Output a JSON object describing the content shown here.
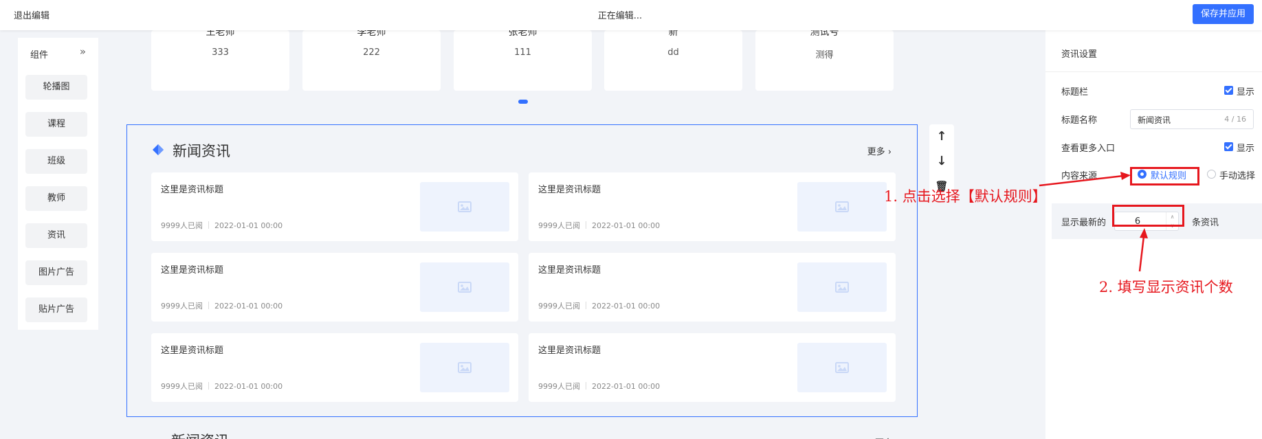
{
  "topbar": {
    "exit_label": "退出编辑",
    "status_text": "正在编辑...",
    "save_label": "保存并应用"
  },
  "components": {
    "header": "组件",
    "collapse_icon": "»",
    "items": [
      "轮播图",
      "课程",
      "班级",
      "教师",
      "资讯",
      "图片广告",
      "贴片广告"
    ]
  },
  "teachers": [
    {
      "name": "王老师",
      "desc": "333"
    },
    {
      "name": "李老师",
      "desc": "222"
    },
    {
      "name": "张老师",
      "desc": "111"
    },
    {
      "name": "新",
      "desc": "dd"
    },
    {
      "name": "测试号",
      "desc": "测得"
    }
  ],
  "news_block": {
    "title": "新闻资讯",
    "more_label": "更多 ›",
    "items": [
      {
        "title": "这里是资讯标题",
        "views": "9999人已阅",
        "date": "2022-01-01 00:00"
      },
      {
        "title": "这里是资讯标题",
        "views": "9999人已阅",
        "date": "2022-01-01 00:00"
      },
      {
        "title": "这里是资讯标题",
        "views": "9999人已阅",
        "date": "2022-01-01 00:00"
      },
      {
        "title": "这里是资讯标题",
        "views": "9999人已阅",
        "date": "2022-01-01 00:00"
      },
      {
        "title": "这里是资讯标题",
        "views": "9999人已阅",
        "date": "2022-01-01 00:00"
      },
      {
        "title": "这里是资讯标题",
        "views": "9999人已阅",
        "date": "2022-01-01 00:00"
      }
    ],
    "next_title": "新闻资讯",
    "next_more": "更多"
  },
  "tools": {
    "up": "↑",
    "down": "↓",
    "delete": "🗑"
  },
  "settings": {
    "title": "资讯设置",
    "title_bar_label": "标题栏",
    "title_bar_check": "显示",
    "title_name_label": "标题名称",
    "title_name_value": "新闻资讯",
    "title_name_count": "4 / 16",
    "more_entry_label": "查看更多入口",
    "more_entry_check": "显示",
    "source_label": "内容来源",
    "source_default": "默认规则",
    "source_manual": "手动选择",
    "latest_label": "显示最新的",
    "latest_value": "6",
    "latest_suffix": "条资讯"
  },
  "annotations": {
    "step1": "1. 点击选择【默认规则】",
    "step2": "2. 填写显示资讯个数",
    "color": "#e6161d"
  },
  "colors": {
    "accent": "#3370ff",
    "background": "#f2f4f8"
  }
}
